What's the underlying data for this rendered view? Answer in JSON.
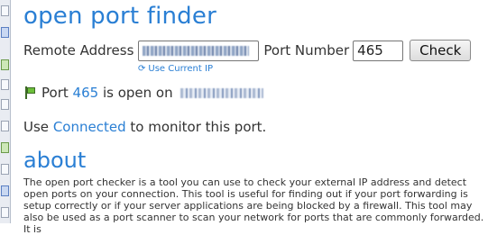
{
  "page": {
    "title": "open port finder",
    "about_heading": "about"
  },
  "form": {
    "remote_address_label": "Remote Address",
    "port_number_label": "Port Number",
    "port_value": "465",
    "check_label": "Check",
    "use_current_ip_label": "Use Current IP"
  },
  "result": {
    "prefix": "Port",
    "port": "465",
    "suffix": "is open on"
  },
  "monitor": {
    "prefix": "Use",
    "link": "Connected",
    "suffix": "to monitor this port."
  },
  "about": {
    "text": "The open port checker is a tool you can use to check your external IP address and detect open ports on your connection. This tool is useful for finding out if your port forwarding is setup correctly or if your server applications are being blocked by a firewall. This tool may also be used as a port scanner to scan your network for ports that are commonly forwarded. It is"
  }
}
